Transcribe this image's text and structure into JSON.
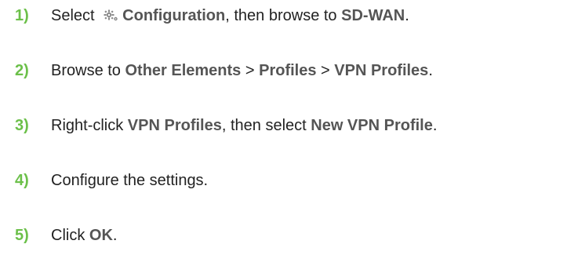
{
  "steps": [
    {
      "number": "1)",
      "parts": [
        {
          "text": "Select ",
          "ui": false
        },
        {
          "icon": "gear-icon"
        },
        {
          "text": "Configuration",
          "ui": true
        },
        {
          "text": ", then browse to ",
          "ui": false
        },
        {
          "text": "SD-WAN",
          "ui": true
        },
        {
          "text": ".",
          "ui": false
        }
      ]
    },
    {
      "number": "2)",
      "parts": [
        {
          "text": "Browse to ",
          "ui": false
        },
        {
          "text": "Other Elements",
          "ui": true
        },
        {
          "text": " > ",
          "ui": false
        },
        {
          "text": "Profiles",
          "ui": true
        },
        {
          "text": " > ",
          "ui": false
        },
        {
          "text": "VPN Profiles",
          "ui": true
        },
        {
          "text": ".",
          "ui": false
        }
      ]
    },
    {
      "number": "3)",
      "parts": [
        {
          "text": "Right-click ",
          "ui": false
        },
        {
          "text": "VPN Profiles",
          "ui": true
        },
        {
          "text": ", then select ",
          "ui": false
        },
        {
          "text": "New VPN Profile",
          "ui": true
        },
        {
          "text": ".",
          "ui": false
        }
      ]
    },
    {
      "number": "4)",
      "parts": [
        {
          "text": "Configure the settings.",
          "ui": false
        }
      ]
    },
    {
      "number": "5)",
      "parts": [
        {
          "text": "Click ",
          "ui": false
        },
        {
          "text": "OK",
          "ui": true
        },
        {
          "text": ".",
          "ui": false
        }
      ]
    }
  ],
  "colors": {
    "step_number": "#6cc04a",
    "ui_term": "#555555",
    "body_text": "#222222",
    "icon": "#888888"
  }
}
